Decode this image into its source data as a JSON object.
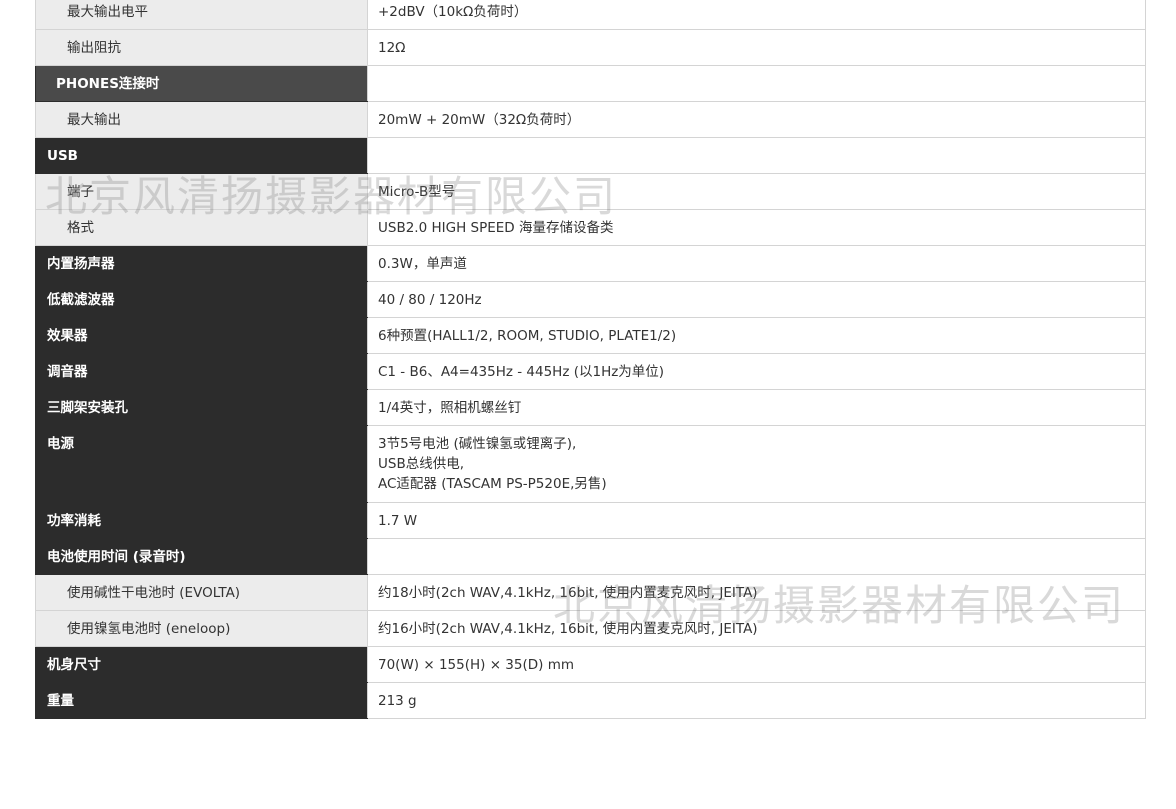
{
  "spec_rows": [
    {
      "level": "sub",
      "label": "最大输出电平",
      "value": "+2dBV（10kΩ负荷时）"
    },
    {
      "level": "sub",
      "label": "输出阻抗",
      "value": "12Ω"
    },
    {
      "level": "mid",
      "label": "PHONES连接时",
      "value": ""
    },
    {
      "level": "sub",
      "label": "最大输出",
      "value": "20mW + 20mW（32Ω负荷时）"
    },
    {
      "level": "top",
      "label": "USB",
      "value": ""
    },
    {
      "level": "sub",
      "label": "端子",
      "value": "Micro-B型号"
    },
    {
      "level": "sub",
      "label": "格式",
      "value": "USB2.0 HIGH SPEED 海量存储设备类"
    },
    {
      "level": "top",
      "label": "内置扬声器",
      "value": "0.3W，单声道"
    },
    {
      "level": "top",
      "label": "低截滤波器",
      "value": "40 / 80 / 120Hz"
    },
    {
      "level": "top",
      "label": "效果器",
      "value": "6种预置(HALL1/2, ROOM, STUDIO, PLATE1/2)"
    },
    {
      "level": "top",
      "label": "调音器",
      "value": "C1 - B6、A4=435Hz - 445Hz (以1Hz为单位)"
    },
    {
      "level": "top",
      "label": "三脚架安装孔",
      "value": "1/4英寸，照相机螺丝钉"
    },
    {
      "level": "top",
      "label": "电源",
      "value": "3节5号电池 (碱性镍氢或锂离子),\nUSB总线供电,\nAC适配器 (TASCAM PS-P520E,另售)"
    },
    {
      "level": "top",
      "label": "功率消耗",
      "value": "1.7 W"
    },
    {
      "level": "top",
      "label": "电池使用时间 (录音时)",
      "value": ""
    },
    {
      "level": "sub",
      "label": "使用碱性干电池时 (EVOLTA)",
      "value": "约18小时(2ch WAV,4.1kHz, 16bit, 使用内置麦克风时, JEITA)"
    },
    {
      "level": "sub",
      "label": "使用镍氢电池时 (eneloop)",
      "value": "约16小时(2ch WAV,4.1kHz, 16bit, 使用内置麦克风时, JEITA)"
    },
    {
      "level": "top",
      "label": "机身尺寸",
      "value": "70(W) × 155(H) × 35(D) mm"
    },
    {
      "level": "top",
      "label": "重量",
      "value": "213 g"
    }
  ],
  "watermark": "北京风清扬摄影器材有限公司",
  "colors": {
    "header_dark": "#2c2c2c",
    "header_mid": "#4a4a4a",
    "sub_label_bg": "#ececec",
    "border": "#d4d4d4"
  }
}
